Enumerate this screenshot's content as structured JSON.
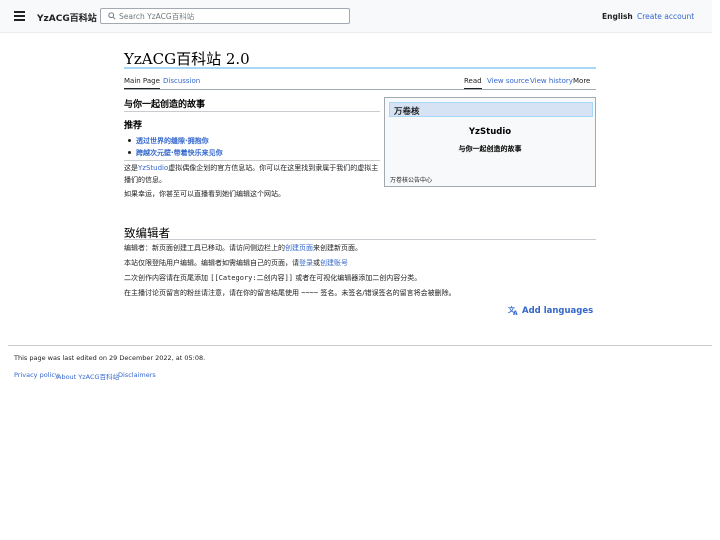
{
  "header": {
    "site_name": "YzACG百科站",
    "search_placeholder": "Search YzACG百科站",
    "language": "English",
    "create_account": "Create account"
  },
  "page": {
    "title": "YzACG百科站 2.0",
    "tabs_left": [
      "Main Page",
      "Discussion"
    ],
    "tabs_right": [
      "Read",
      "View source",
      "View history",
      "More"
    ]
  },
  "content": {
    "heading1": "与你一起创造的故事",
    "heading2": "推荐",
    "recommendations": [
      "透过世界的缝隙·拥抱你",
      "跨越次元壁·带着快乐来见你"
    ],
    "intro_before": "这是",
    "intro_link": "YzStudio",
    "intro_after": "虚拟偶像企划的官方信息站。你可以在这里找到隶属于我们的虚拟主播们的信息。",
    "intro_line2": "如果幸运，你甚至可以直播看到她们编辑这个网站。",
    "editor_heading": "致编辑者",
    "editor_p1_before": "编辑者：新页面创建工具已移动。请访问侧边栏上的",
    "editor_p1_link": "创建页面",
    "editor_p1_after": "来创建新页面。",
    "editor_p2_before": "本站仅限登陆用户编辑。编辑者如需编辑自己的页面，请",
    "editor_p2_link1": "登录",
    "editor_p2_mid": "或",
    "editor_p2_link2": "创建账号",
    "editor_p3_before": "二次创作内容请在页尾添加 ",
    "editor_p3_code": "[[Category:二创内容]]",
    "editor_p3_after": " 或者在可视化编辑器添加二创内容分类。",
    "editor_p4_before": "在主播讨论页留言的粉丝请注意，请在你的留言结尾使用 ",
    "editor_p4_code": "~~~~",
    "editor_p4_after": " 签名。未签名/错误签名的留言将会被删除。"
  },
  "infobox": {
    "header": "万卷核",
    "studio": "YzStudio",
    "slogan": "与你一起创造的故事",
    "footer": "万卷核公告中心"
  },
  "add_languages": "Add languages",
  "footer": {
    "last_edited": "This page was last edited on 29 December 2022, at 05:08.",
    "links": [
      "Privacy policy",
      "About YzACG百科站",
      "Disclaimers"
    ]
  },
  "colors": {
    "link": "#3366cc",
    "header_bg": "#f8f9fa",
    "title_rule": "#a7d7f9"
  }
}
